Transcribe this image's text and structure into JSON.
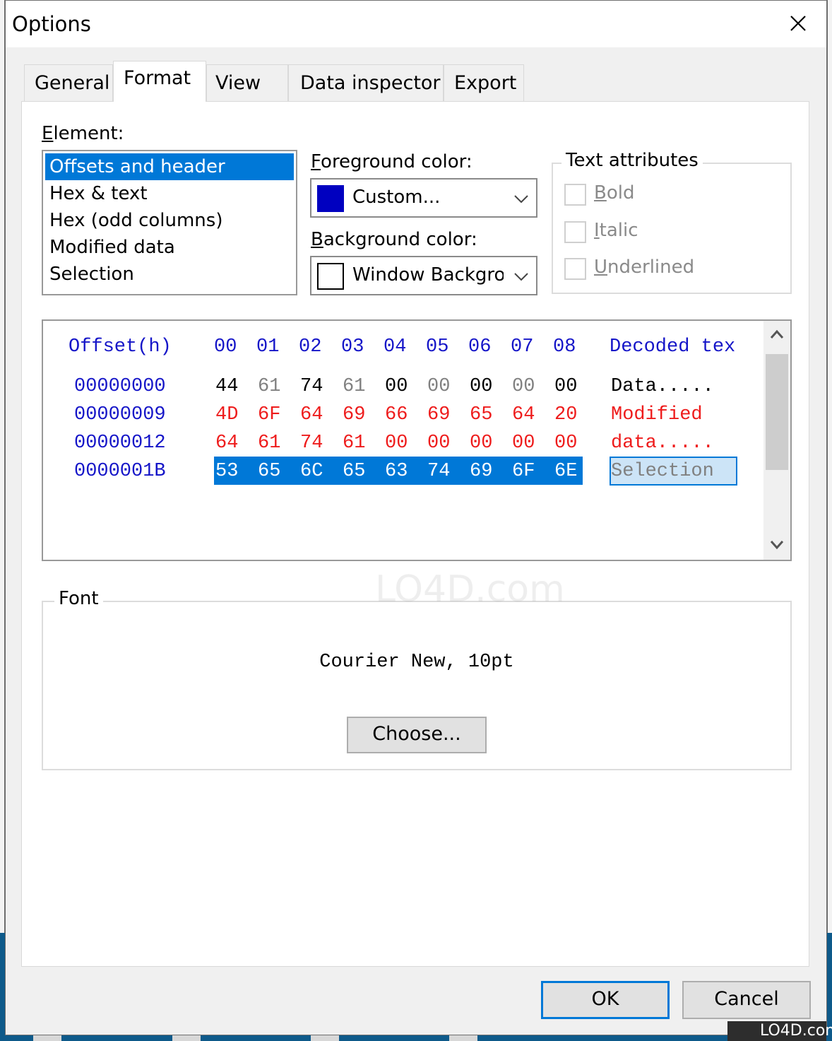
{
  "window": {
    "title": "Options",
    "close_icon": "close-x-icon"
  },
  "tabs": [
    {
      "label": "General",
      "active": false
    },
    {
      "label": "Format",
      "active": true
    },
    {
      "label": "View",
      "active": false
    },
    {
      "label": "Data inspector",
      "active": false
    },
    {
      "label": "Export",
      "active": false
    }
  ],
  "format": {
    "element_label": "Element:",
    "element_label_accel": "E",
    "elements": [
      {
        "label": "Offsets and header",
        "selected": true
      },
      {
        "label": "Hex & text",
        "selected": false
      },
      {
        "label": "Hex (odd columns)",
        "selected": false
      },
      {
        "label": "Modified data",
        "selected": false
      },
      {
        "label": "Selection",
        "selected": false
      }
    ],
    "foreground": {
      "label": "Foreground color:",
      "accel": "F",
      "value": "Custom...",
      "swatch_color": "#0000c0"
    },
    "background": {
      "label": "Background color:",
      "accel": "B",
      "value": "Window Background",
      "swatch_color": "#ffffff"
    },
    "text_attributes": {
      "title": "Text attributes",
      "options": [
        {
          "label": "Bold",
          "accel": "B",
          "checked": false,
          "enabled": false
        },
        {
          "label": "Italic",
          "accel": "I",
          "checked": false,
          "enabled": false
        },
        {
          "label": "Underlined",
          "accel": "U",
          "checked": false,
          "enabled": false
        }
      ]
    }
  },
  "preview": {
    "header": {
      "offset_label": "Offset(h)",
      "columns": [
        "00",
        "01",
        "02",
        "03",
        "04",
        "05",
        "06",
        "07",
        "08"
      ],
      "decoded_label": "Decoded tex"
    },
    "rows": [
      {
        "offset": "00000000",
        "bytes": [
          "44",
          "61",
          "74",
          "61",
          "00",
          "00",
          "00",
          "00",
          "00"
        ],
        "decoded": "Data.....",
        "style": "normal"
      },
      {
        "offset": "00000009",
        "bytes": [
          "4D",
          "6F",
          "64",
          "69",
          "66",
          "69",
          "65",
          "64",
          "20"
        ],
        "decoded": "Modified ",
        "style": "modified"
      },
      {
        "offset": "00000012",
        "bytes": [
          "64",
          "61",
          "74",
          "61",
          "00",
          "00",
          "00",
          "00",
          "00"
        ],
        "decoded": "data.....",
        "style": "modified"
      },
      {
        "offset": "0000001B",
        "bytes": [
          "53",
          "65",
          "6C",
          "65",
          "63",
          "74",
          "69",
          "6F",
          "6E"
        ],
        "decoded": "Selection",
        "style": "selected"
      }
    ],
    "colors": {
      "offset": "#1515c8",
      "modified": "#ee1c1c",
      "odd_column": "#808080",
      "selection_bg": "#0078d7",
      "selection_text_bg": "#cce4f7"
    }
  },
  "font": {
    "group_title": "Font",
    "current": "Courier New, 10pt",
    "choose_label": "Choose..."
  },
  "buttons": {
    "ok": "OK",
    "cancel": "Cancel"
  },
  "watermark": "LO4D.com"
}
